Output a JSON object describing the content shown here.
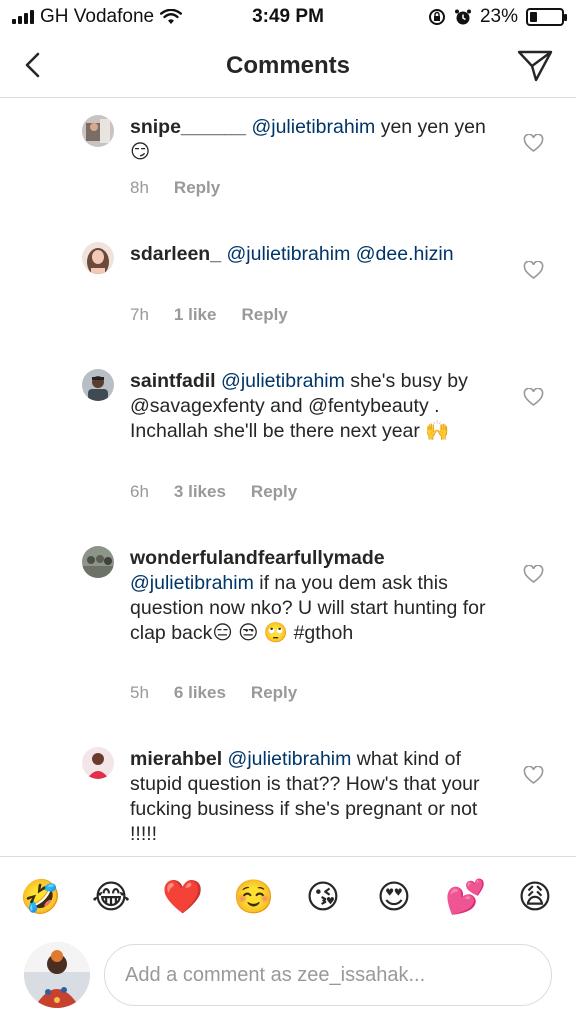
{
  "status_bar": {
    "carrier": "GH Vodafone",
    "time": "3:49 PM",
    "battery": "23%",
    "battery_level": 0.23
  },
  "header": {
    "title": "Comments",
    "back_icon": "chevron-left-icon",
    "send_icon": "paper-plane-icon"
  },
  "comments": [
    {
      "username": "snipe______",
      "mention": "@julietibrahim",
      "text": " yen yen yen 😏",
      "time": "8h",
      "likes": "",
      "reply": "Reply"
    },
    {
      "username": "sdarleen_",
      "mention": "@julietibrahim",
      "text": " @dee.hizin",
      "time": "7h",
      "likes": "1 like",
      "reply": "Reply"
    },
    {
      "username": "saintfadil",
      "mention": "@julietibrahim",
      "text": " she's busy by @savagexfenty and @fentybeauty . Inchallah she'll be there next year 🙌",
      "time": "6h",
      "likes": "3 likes",
      "reply": "Reply"
    },
    {
      "username": "wonderfulandfearfullymade",
      "mention": "@julietibrahim",
      "text": " if na you dem ask this question now nko? U will start hunting for clap back😑 😒 🙄 #gthoh",
      "time": "5h",
      "likes": "6 likes",
      "reply": "Reply"
    },
    {
      "username": "mierahbel",
      "mention": "@julietibrahim",
      "text": " what kind of stupid question is that?? How's that your fucking business if she's pregnant or not !!!!!",
      "time": "",
      "likes": "",
      "reply": ""
    }
  ],
  "emojis": [
    "🤣",
    "😂",
    "❤️",
    "☺️",
    "😘",
    "😍",
    "💕",
    "😩"
  ],
  "composer": {
    "placeholder": "Add a comment as zee_issahak..."
  },
  "colors": {
    "mention": "#003569",
    "meta": "#999999",
    "divider": "#dbdbdb"
  }
}
